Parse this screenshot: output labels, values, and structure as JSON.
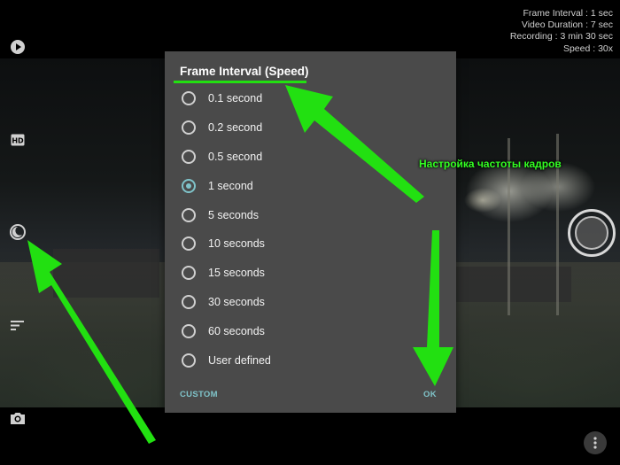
{
  "status": {
    "frame_interval": "Frame Interval : 1 sec",
    "video_duration": "Video Duration : 7 sec",
    "recording": "Recording : 3 min 30 sec",
    "speed": "Speed : 30x"
  },
  "toolbar": {
    "icons": [
      "play-icon",
      "hd-icon",
      "night-mode-icon",
      "filter-icon",
      "camera-icon"
    ]
  },
  "dialog": {
    "title": "Frame Interval (Speed)",
    "options": [
      {
        "label": "0.1 second",
        "checked": false
      },
      {
        "label": "0.2 second",
        "checked": false
      },
      {
        "label": "0.5 second",
        "checked": false
      },
      {
        "label": "1 second",
        "checked": true
      },
      {
        "label": "5 seconds",
        "checked": false
      },
      {
        "label": "10 seconds",
        "checked": false
      },
      {
        "label": "15 seconds",
        "checked": false
      },
      {
        "label": "30 seconds",
        "checked": false
      },
      {
        "label": "60 seconds",
        "checked": false
      },
      {
        "label": "User defined",
        "checked": false
      }
    ],
    "custom_label": "CUSTOM",
    "ok_label": "OK"
  },
  "annotation": {
    "text": "Настройка частоты кадров",
    "color": "#33ff22"
  },
  "colors": {
    "accent": "#7fc3c9",
    "dialog_bg": "#4a4a4a",
    "highlight": "#22e011"
  }
}
